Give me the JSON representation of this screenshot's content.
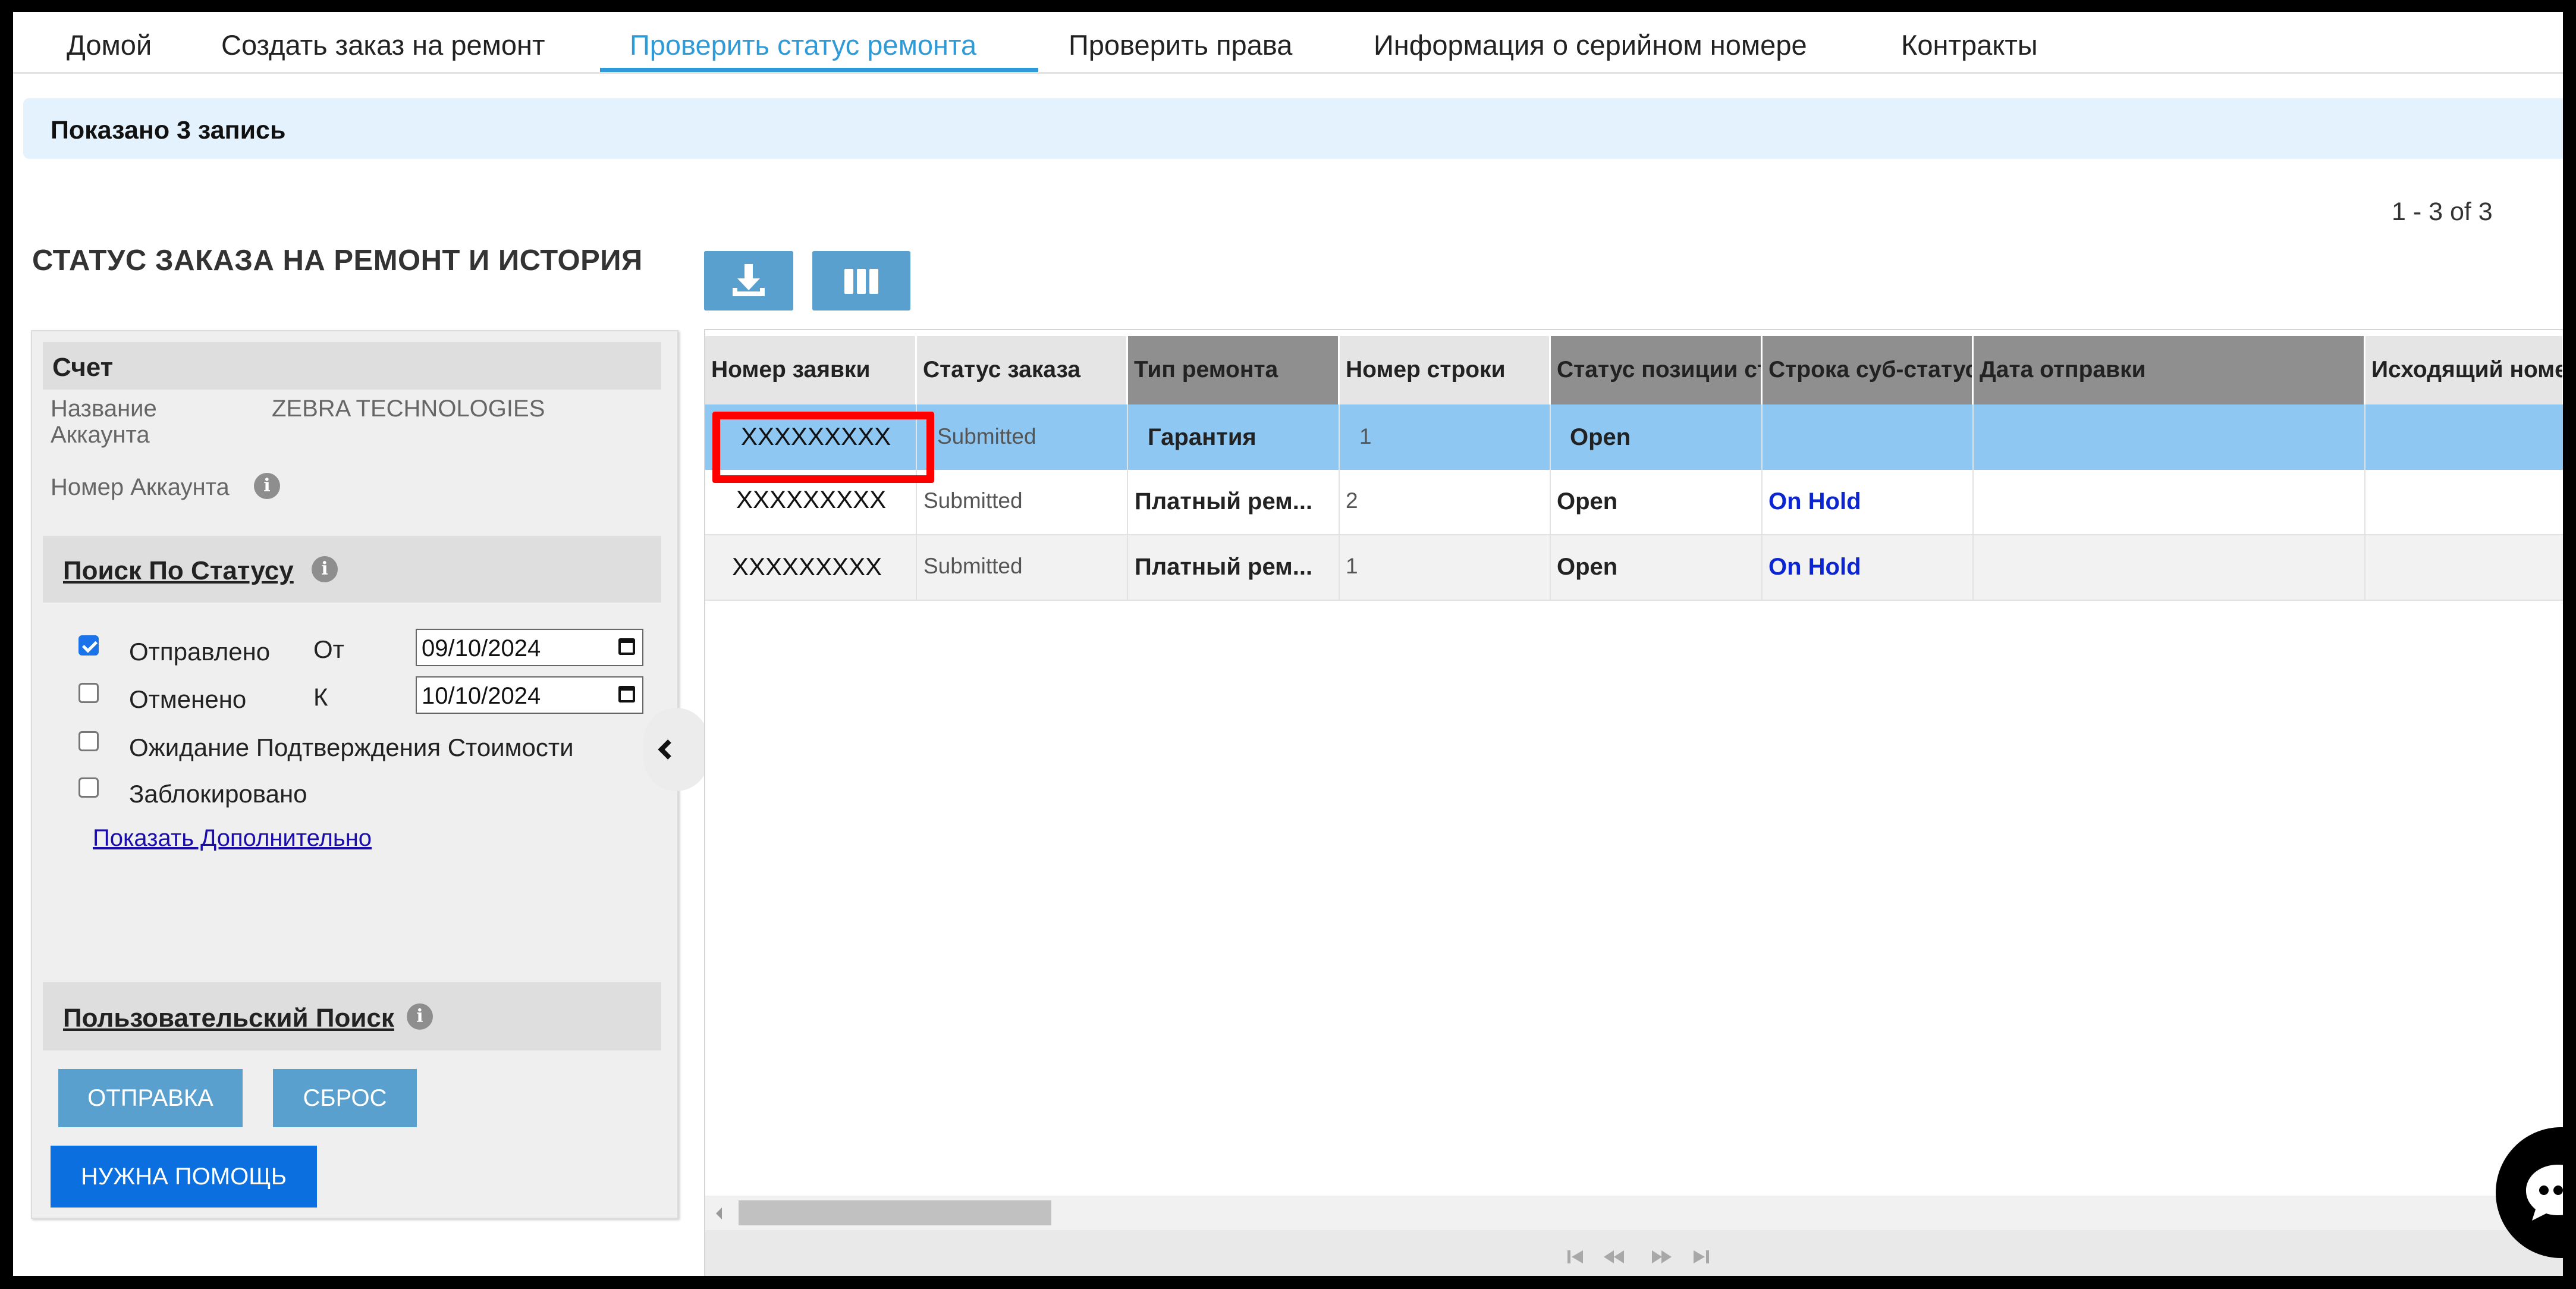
{
  "nav": {
    "tabs": [
      {
        "label": "Домой"
      },
      {
        "label": "Создать заказ на ремонт"
      },
      {
        "label": "Проверить статус ремонта"
      },
      {
        "label": "Проверить права"
      },
      {
        "label": "Информация о серийном номере"
      },
      {
        "label": "Контракты"
      }
    ],
    "active": "Проверить статус ремонта"
  },
  "info_bar": {
    "text": "Показано 3 запись"
  },
  "pager": {
    "text": "1 - 3 of 3"
  },
  "page_title": "СТАТУС ЗАКАЗА НА РЕМОНТ И ИСТОРИЯ",
  "left_panel": {
    "account_header": "Счет",
    "account_name_label_line1": "Название",
    "account_name_label_line2": "Аккаунта",
    "account_name_value": "ZEBRA TECHNOLOGIES",
    "account_number_label": "Номер Аккаунта",
    "status_search_title": "Поиск По Статусу",
    "checkboxes": [
      {
        "label": "Отправлено",
        "checked": true
      },
      {
        "label": "Отменено",
        "checked": false
      },
      {
        "label": "Ожидание Подтверждения Стоимости",
        "checked": false
      },
      {
        "label": "Заблокировано",
        "checked": false
      }
    ],
    "from_label": "От",
    "to_label": "К",
    "from_date": "09/10/2024",
    "to_date": "10/10/2024",
    "show_more_link": "Показать Дополнительно",
    "custom_search_title": "Пользовательский Поиск",
    "submit_button": "ОТПРАВКА",
    "reset_button": "СБРОС",
    "help_button": "НУЖНА ПОМОЩЬ"
  },
  "grid": {
    "columns": [
      "Номер заявки",
      "Статус заказа",
      "Тип ремонта",
      "Номер строки",
      "Статус позиции ст",
      "Строка суб-статуса",
      "Дата отправки",
      "Исходящий номе"
    ],
    "rows": [
      {
        "ticket": "XXXXXXXXX",
        "order_status": "Submitted",
        "repair_type": "Гарантия",
        "line_number": "1",
        "item_status": "Open",
        "sub_status": "",
        "ship_date": "",
        "outgoing": ""
      },
      {
        "ticket": "XXXXXXXXX",
        "order_status": "Submitted",
        "repair_type": "Платный рем...",
        "line_number": "2",
        "item_status": "Open",
        "sub_status": "On Hold",
        "ship_date": "",
        "outgoing": ""
      },
      {
        "ticket": "XXXXXXXXX",
        "order_status": "Submitted",
        "repair_type": "Платный рем...",
        "line_number": "1",
        "item_status": "Open",
        "sub_status": "On Hold",
        "ship_date": "",
        "outgoing": ""
      }
    ],
    "selected_row": 1
  },
  "colors": {
    "accent": "#2e9bd8",
    "selected_row": "#8ec8f2",
    "highlight": "#ff0000",
    "on_hold": "#0a25d1",
    "primary_button": "#0b6fdf",
    "secondary_button": "#5aa0cf"
  },
  "icons": {
    "download": "download-icon",
    "columns": "columns-icon",
    "chat": "chat-icon",
    "collapse": "chevron-left-icon"
  }
}
